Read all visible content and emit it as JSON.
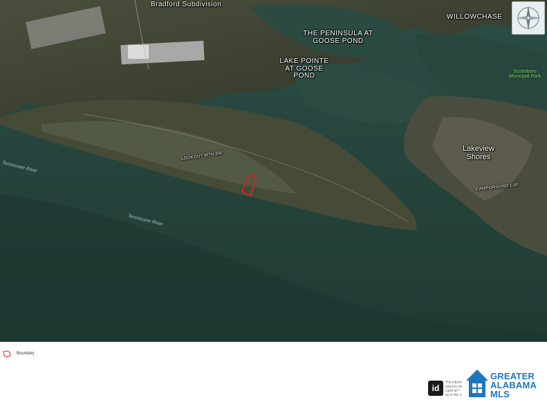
{
  "map": {
    "labels": {
      "bradford": "Bradford Subdivision",
      "peninsula": "THE PENINSULA AT GOOSE POND",
      "lake_pointe": "LAKE POINTE AT GOOSE POND",
      "willowchase": "WILLOWCHASE",
      "park": "Scottsboro Municipal Park",
      "lakeview": "Lakeview Shores",
      "lookout_road": "LOOKOUT MTN DR",
      "river_1": "Tennessee River",
      "river_2": "Tennessee River",
      "campground_road": "CAMPGROUND CIR"
    },
    "compass_icon": "compass-rose-icon",
    "boundary_color": "#e0202a"
  },
  "legend": {
    "icon": "boundary-outline-icon",
    "label": "Boundary"
  },
  "footer": {
    "id_logo_text": "id",
    "disclaimer_lines": [
      "The inform",
      "sources de",
      "Land id™",
      "as to the a"
    ],
    "mls_lines": [
      "GREATER",
      "ALABAMA",
      "MLS"
    ],
    "mls_color": "#1f76c0"
  }
}
